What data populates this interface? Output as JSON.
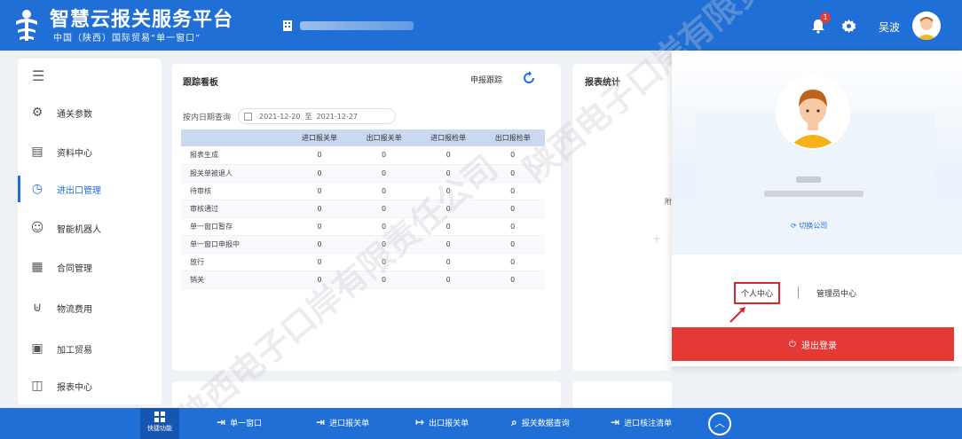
{
  "header": {
    "title": "智慧云报关服务平台",
    "subtitle": "中国（陕西）国际贸易“单一窗口”",
    "notification_count": "1",
    "username": "吴波"
  },
  "sidebar": {
    "items": [
      {
        "label": "通关参数",
        "icon": "settings-icon"
      },
      {
        "label": "资料中心",
        "icon": "document-icon"
      },
      {
        "label": "进出口管理",
        "icon": "clock-icon",
        "active": true
      },
      {
        "label": "智能机器人",
        "icon": "robot-icon"
      },
      {
        "label": "合同管理",
        "icon": "contract-icon"
      },
      {
        "label": "物流费用",
        "icon": "cart-icon"
      },
      {
        "label": "加工贸易",
        "icon": "factory-icon"
      },
      {
        "label": "报表中心",
        "icon": "report-icon"
      }
    ]
  },
  "panel": {
    "title": "跟踪看板",
    "tag": "申报跟踪",
    "date_label": "按内日期查询",
    "date_from": "2021-12-20",
    "date_sep": "至",
    "date_to": "2021-12-27",
    "columns": [
      "",
      "进口报关单",
      "出口报关单",
      "进口报检单",
      "出口报检单"
    ],
    "rows": [
      [
        "报表生成",
        "0",
        "0",
        "0",
        "0"
      ],
      [
        "报关单被退人",
        "0",
        "0",
        "0",
        "0"
      ],
      [
        "待审核",
        "0",
        "0",
        "0",
        "0"
      ],
      [
        "审核通过",
        "0",
        "0",
        "0",
        "0"
      ],
      [
        "单一窗口暂存",
        "0",
        "0",
        "0",
        "0"
      ],
      [
        "单一窗口申报中",
        "0",
        "0",
        "0",
        "0"
      ],
      [
        "放行",
        "0",
        "0",
        "0",
        "0"
      ],
      [
        "销关",
        "0",
        "0",
        "0",
        "0"
      ]
    ]
  },
  "panel2": {
    "title": "报表统计",
    "mark": "附"
  },
  "dropdown": {
    "switch_label": "切换公司",
    "personal_center": "个人中心",
    "admin_center": "管理员中心",
    "logout": "退出登录"
  },
  "toolbar": {
    "home_label": "快捷功能",
    "items": [
      {
        "label": "单一窗口",
        "icon": "login-icon"
      },
      {
        "label": "进口报关单",
        "icon": "import-icon"
      },
      {
        "label": "出口报关单",
        "icon": "export-icon"
      },
      {
        "label": "报关数据查询",
        "icon": "search-icon"
      },
      {
        "label": "进口核注清单",
        "icon": "list-icon"
      }
    ]
  },
  "watermark": "陕西电子口岸有限责任公司",
  "colors": {
    "primary": "#1f6fd6",
    "logout_red": "#e53935",
    "highlight_red": "#d9262b"
  }
}
